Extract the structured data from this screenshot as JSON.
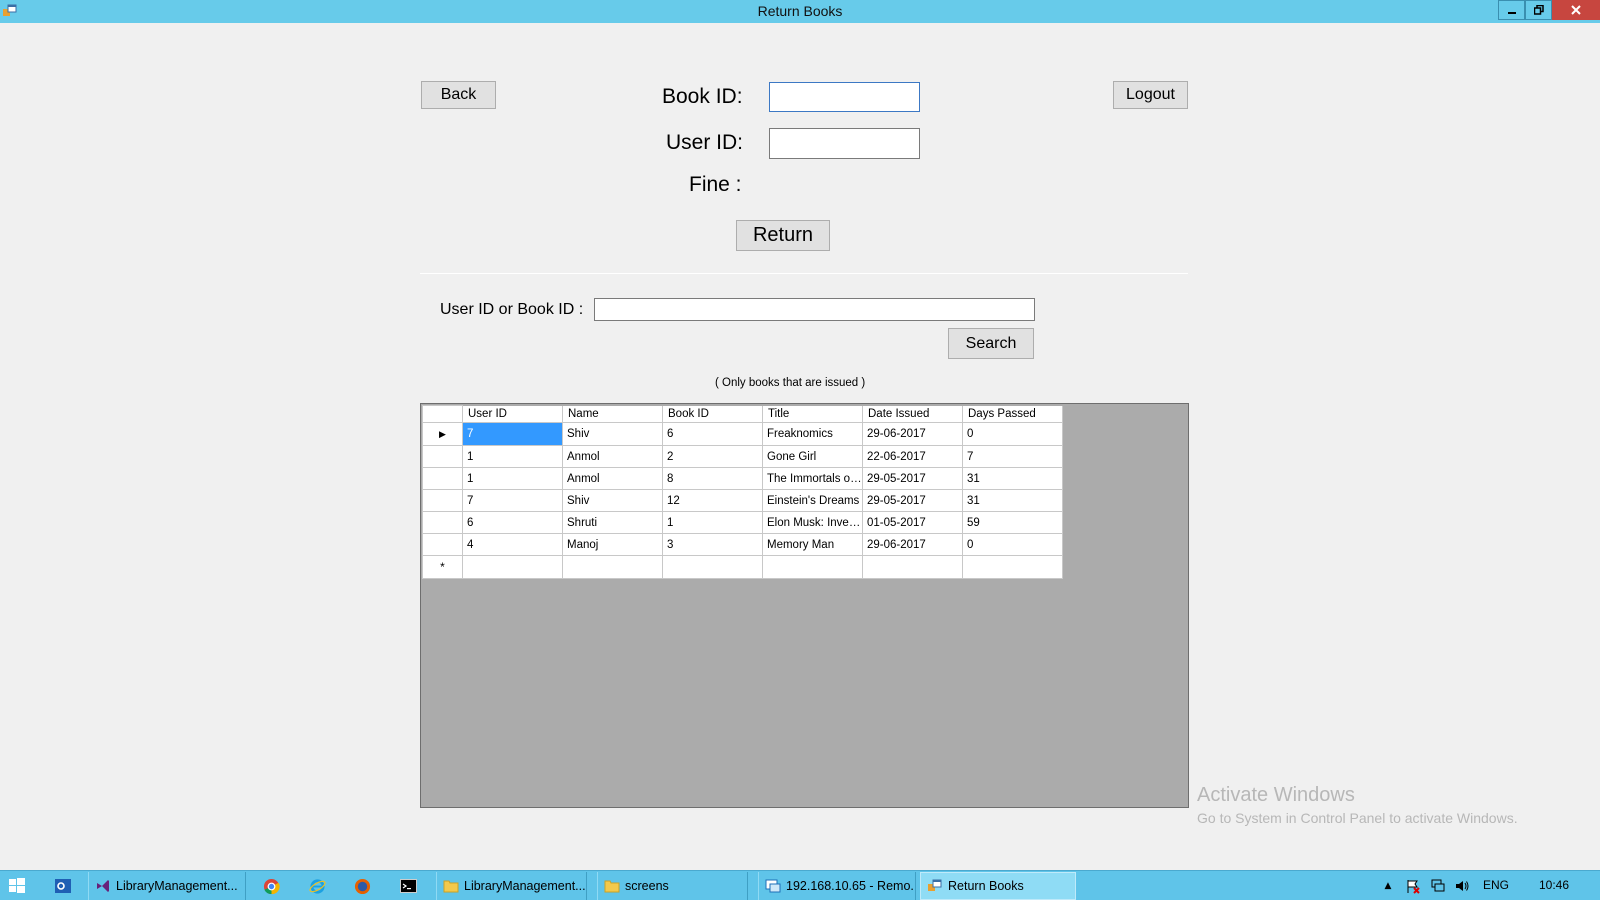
{
  "window": {
    "title": "Return Books"
  },
  "toolbar": {
    "back_label": "Back",
    "logout_label": "Logout"
  },
  "form": {
    "book_id_label": "Book ID:",
    "book_id_value": "",
    "user_id_label": "User ID:",
    "user_id_value": "",
    "fine_label": "Fine :",
    "return_label": "Return"
  },
  "search": {
    "label": "User ID or Book ID :",
    "value": "",
    "button_label": "Search",
    "note": "( Only books that are issued )"
  },
  "grid": {
    "columns": [
      "User ID",
      "Name",
      "Book ID",
      "Title",
      "Date Issued",
      "Days Passed"
    ],
    "rows": [
      [
        "7",
        "Shiv",
        "6",
        "Freaknomics",
        "29-06-2017",
        "0"
      ],
      [
        "1",
        "Anmol",
        "2",
        "Gone Girl",
        "22-06-2017",
        "7"
      ],
      [
        "1",
        "Anmol",
        "8",
        "The Immortals of ...",
        "29-05-2017",
        "31"
      ],
      [
        "7",
        "Shiv",
        "12",
        "Einstein's Dreams",
        "29-05-2017",
        "31"
      ],
      [
        "6",
        "Shruti",
        "1",
        "Elon Musk: Inven...",
        "01-05-2017",
        "59"
      ],
      [
        "4",
        "Manoj",
        "3",
        "Memory Man",
        "29-06-2017",
        "0"
      ]
    ],
    "current_row_marker": "▶",
    "new_row_marker": "*"
  },
  "watermark": {
    "line1": "Activate Windows",
    "line2": "Go to System in Control Panel to activate Windows."
  },
  "taskbar": {
    "items": [
      "LibraryManagement...",
      "LibraryManagement...",
      "screens",
      "192.168.10.65 - Remo...",
      "Return Books"
    ],
    "language": "ENG",
    "clock": "10:46"
  },
  "colors": {
    "titlebar": "#67cbea",
    "taskbar": "#5fc4e9",
    "selection": "#3399ff",
    "close_button": "#c7463f"
  }
}
